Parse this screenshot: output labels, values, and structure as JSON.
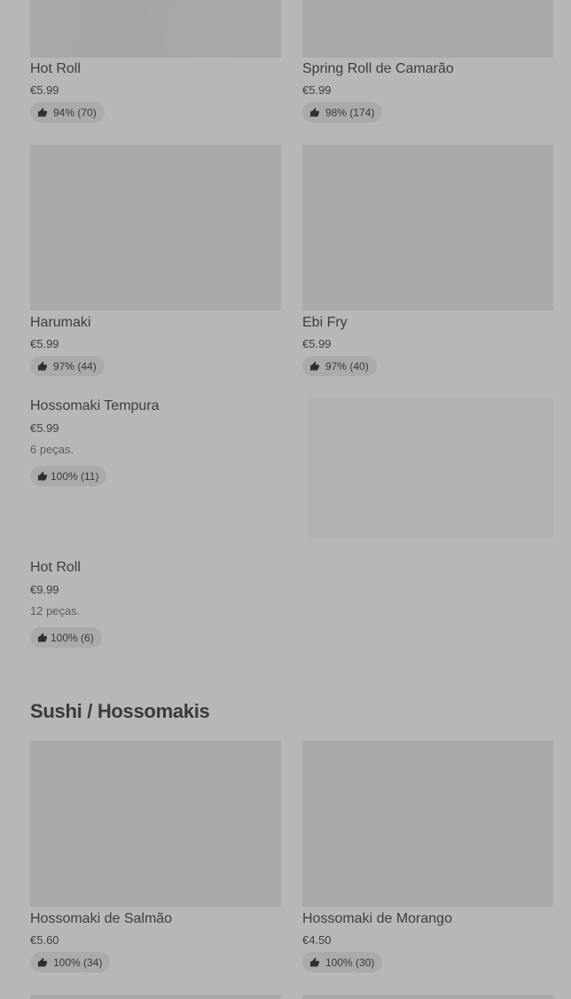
{
  "colors": {
    "overlay_background": "#b7b7b7",
    "image_placeholder": "#a9a9a9",
    "badge_background": "#aaaaaa",
    "text": "#3d3d3d"
  },
  "grid_top": [
    {
      "name": "Hot Roll",
      "price": "€5.99",
      "rating": "94% (70)"
    },
    {
      "name": "Spring Roll de Camarão",
      "price": "€5.99",
      "rating": "98% (174)"
    },
    {
      "name": "Harumaki",
      "price": "€5.99",
      "rating": "97% (44)"
    },
    {
      "name": "Ebi Fry",
      "price": "€5.99",
      "rating": "97% (40)"
    }
  ],
  "list_items": [
    {
      "name": "Hossomaki Tempura",
      "price": "€5.99",
      "pieces": "6 peças.",
      "rating": "100% (11)"
    },
    {
      "name": "Hot Roll",
      "price": "€9.99",
      "pieces": "12 peças.",
      "rating": "100% (6)"
    }
  ],
  "section": {
    "title": "Sushi / Hossomakis"
  },
  "grid_sushi": [
    {
      "name": "Hossomaki de Salmão",
      "price": "€5.60",
      "rating": "100% (34)"
    },
    {
      "name": "Hossomaki de Morango",
      "price": "€4.50",
      "rating": "100% (30)"
    }
  ],
  "icons": {
    "rating": "thumbs-up-icon"
  }
}
